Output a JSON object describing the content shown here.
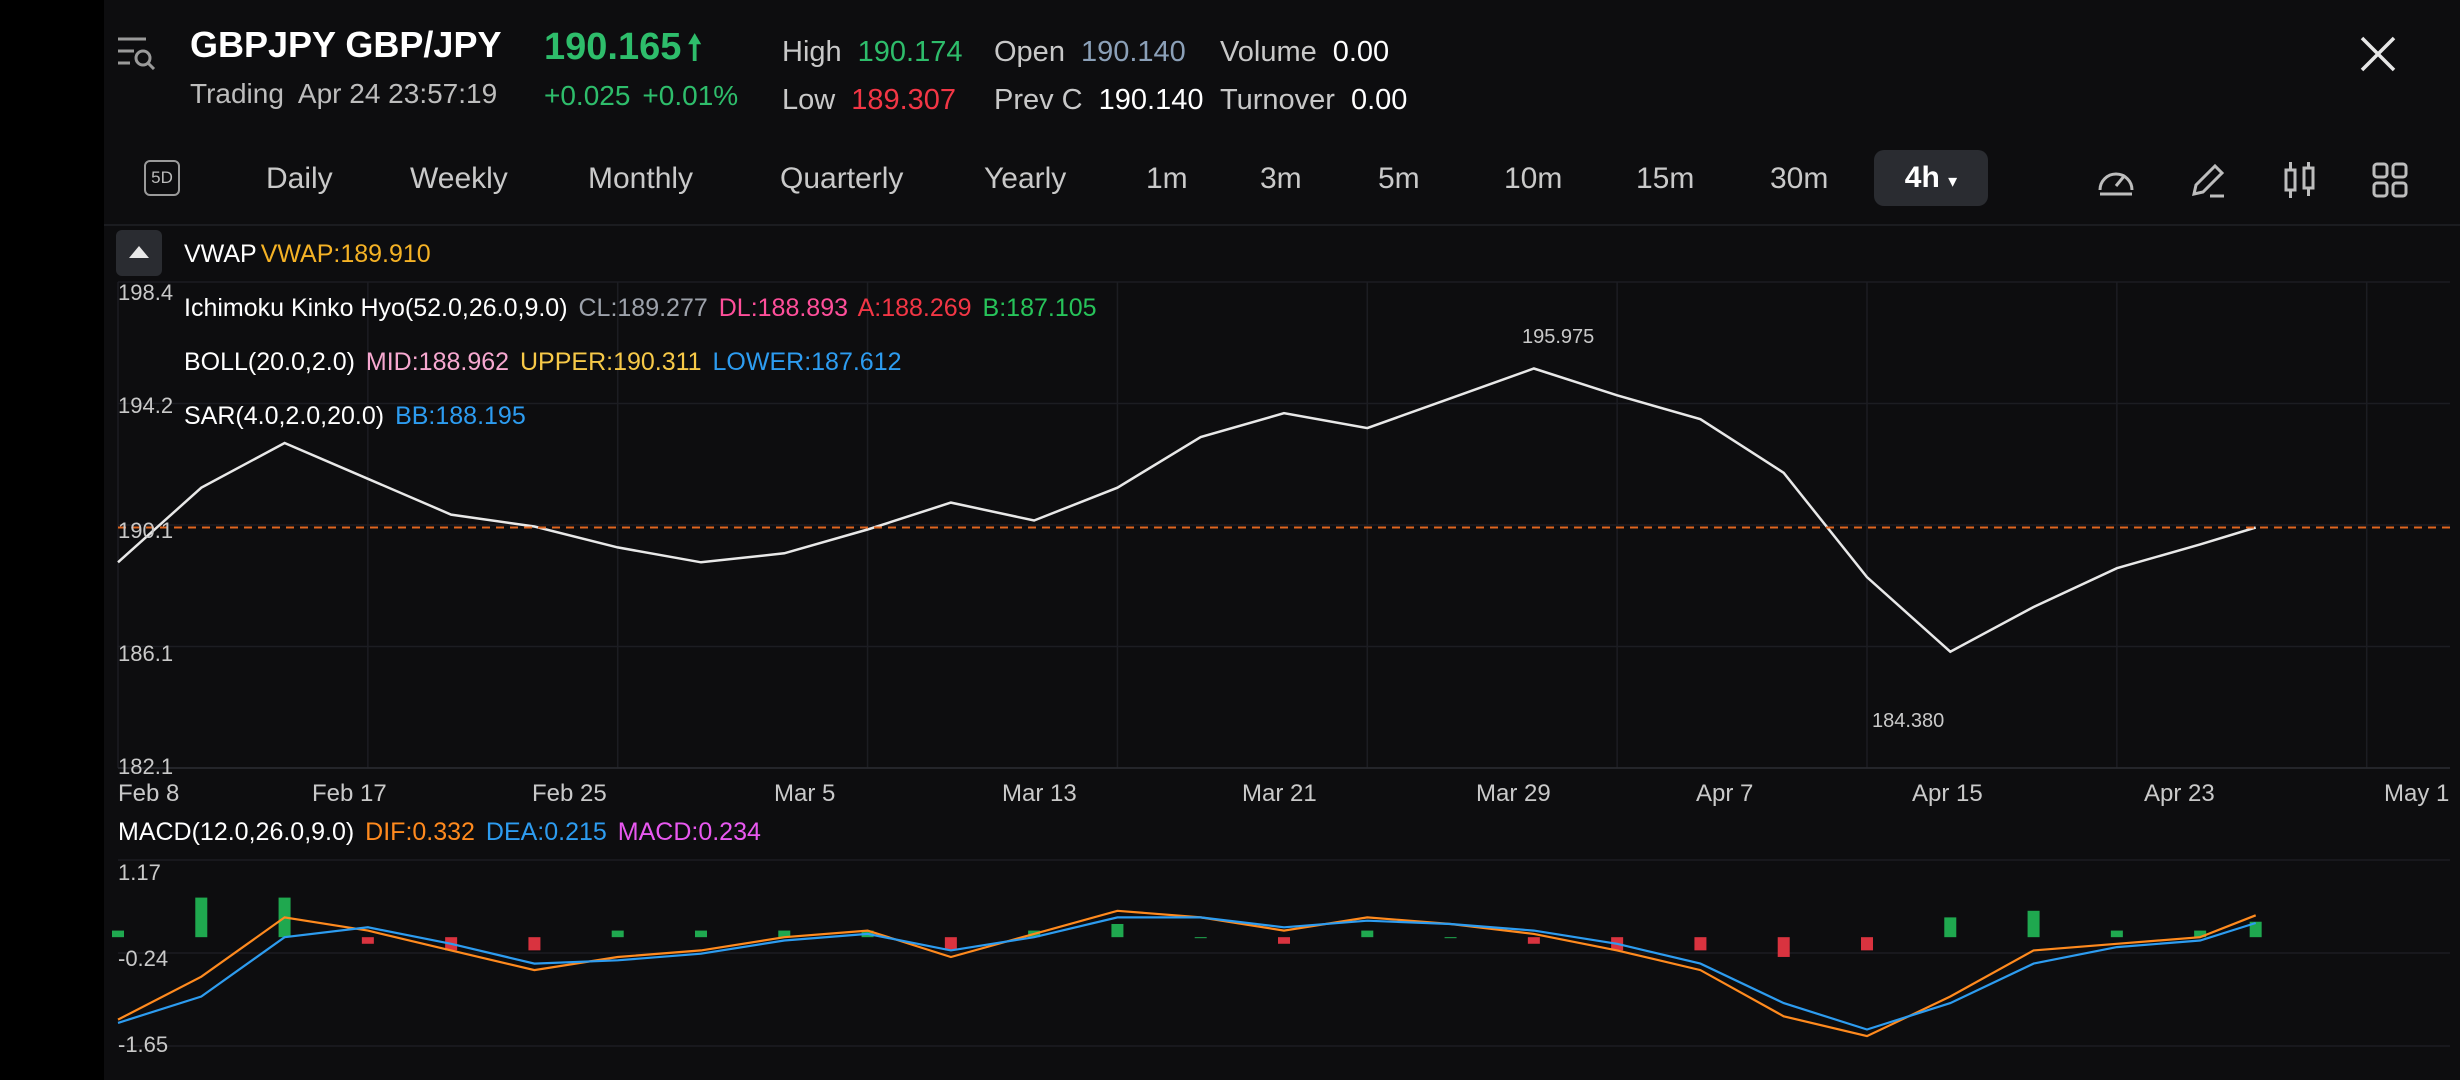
{
  "header": {
    "symbol": "GBPJPY GBP/JPY",
    "status": "Trading",
    "datetime": "Apr 24 23:57:19",
    "price": "190.165",
    "change": "+0.025",
    "change_pct": "+0.01%",
    "stats": {
      "high_label": "High",
      "high": "190.174",
      "low_label": "Low",
      "low": "189.307",
      "open_label": "Open",
      "open": "190.140",
      "prevc_label": "Prev C",
      "prevc": "190.140",
      "volume_label": "Volume",
      "volume": "0.00",
      "turnover_label": "Turnover",
      "turnover": "0.00"
    }
  },
  "toolbar": {
    "five_d": "5D",
    "timeframes": [
      "Daily",
      "Weekly",
      "Monthly",
      "Quarterly",
      "Yearly",
      "1m",
      "3m",
      "5m",
      "10m",
      "15m",
      "30m"
    ],
    "active": "4h",
    "icons": [
      "gauge-icon",
      "pencil-icon",
      "candlestick-icon",
      "grid-icon"
    ]
  },
  "indicators": {
    "vwap": {
      "name": "VWAP",
      "value": "VWAP:189.910"
    },
    "ichimoku": {
      "name": "Ichimoku Kinko Hyo(52.0,26.0,9.0)",
      "cl": "CL:189.277",
      "dl": "DL:188.893",
      "a": "A:188.269",
      "b": "B:187.105"
    },
    "boll": {
      "name": "BOLL(20.0,2.0)",
      "mid": "MID:188.962",
      "upper": "UPPER:190.311",
      "lower": "LOWER:187.612"
    },
    "sar": {
      "name": "SAR(4.0,2.0,20.0)",
      "bb": "BB:188.195"
    },
    "macd": {
      "name": "MACD(12.0,26.0,9.0)",
      "dif": "DIF:0.332",
      "dea": "DEA:0.215",
      "macd": "MACD:0.234"
    }
  },
  "chart_data": [
    {
      "type": "line",
      "title": "",
      "yticks": [
        "198.4",
        "194.2",
        "190.1",
        "186.1",
        "182.1"
      ],
      "ylim": [
        182.1,
        198.4
      ],
      "xticks": [
        "Feb 8",
        "Feb 17",
        "Feb 25",
        "Mar 5",
        "Mar 13",
        "Mar 21",
        "Mar 29",
        "Apr 7",
        "Apr 15",
        "Apr 23",
        "May 1"
      ],
      "annotations": [
        "195.975",
        "184.380"
      ],
      "current_price": 190.165,
      "x": [
        0,
        3,
        6,
        9,
        12,
        15,
        18,
        21,
        24,
        27,
        30,
        33,
        36,
        39,
        42,
        45,
        48,
        51,
        54,
        57,
        60,
        63,
        66,
        69,
        72,
        75,
        77
      ],
      "series": [
        {
          "values": [
            189.0,
            191.5,
            193.0,
            191.8,
            190.6,
            190.2,
            189.5,
            189.0,
            189.3,
            190.1,
            191.0,
            190.4,
            191.5,
            193.2,
            194.0,
            193.5,
            194.5,
            195.5,
            194.6,
            193.8,
            192.0,
            188.5,
            186.0,
            187.5,
            188.8,
            189.6,
            190.165
          ]
        }
      ]
    },
    {
      "type": "bar",
      "title": "",
      "yticks": [
        "1.17",
        "-0.24",
        "-1.65"
      ],
      "ylim": [
        -1.65,
        1.17
      ],
      "x": [
        0,
        3,
        6,
        9,
        12,
        15,
        18,
        21,
        24,
        27,
        30,
        33,
        36,
        39,
        42,
        45,
        48,
        51,
        54,
        57,
        60,
        63,
        66,
        69,
        72,
        75,
        77
      ],
      "series": [
        {
          "name": "DIF",
          "values": [
            -1.25,
            -0.6,
            0.3,
            0.1,
            -0.2,
            -0.5,
            -0.3,
            -0.2,
            0.0,
            0.1,
            -0.3,
            0.05,
            0.4,
            0.3,
            0.1,
            0.3,
            0.2,
            0.05,
            -0.2,
            -0.5,
            -1.2,
            -1.5,
            -0.9,
            -0.2,
            -0.1,
            0.0,
            0.332
          ]
        },
        {
          "name": "DEA",
          "values": [
            -1.3,
            -0.9,
            0.0,
            0.15,
            -0.1,
            -0.4,
            -0.35,
            -0.25,
            -0.05,
            0.05,
            -0.2,
            0.0,
            0.3,
            0.3,
            0.15,
            0.25,
            0.2,
            0.1,
            -0.1,
            -0.4,
            -1.0,
            -1.4,
            -1.0,
            -0.4,
            -0.15,
            -0.05,
            0.215
          ]
        },
        {
          "name": "MACD",
          "values": [
            0.1,
            0.6,
            0.6,
            -0.1,
            -0.2,
            -0.2,
            0.1,
            0.1,
            0.1,
            0.1,
            -0.2,
            0.1,
            0.2,
            0.0,
            -0.1,
            0.1,
            0.0,
            -0.1,
            -0.2,
            -0.2,
            -0.3,
            -0.2,
            0.3,
            0.4,
            0.1,
            0.1,
            0.234
          ]
        }
      ]
    }
  ]
}
